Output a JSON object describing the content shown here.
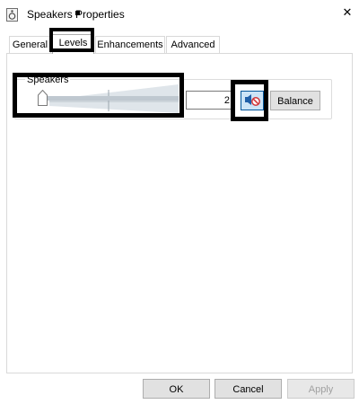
{
  "window": {
    "title": "Speakers Properties",
    "close_glyph": "✕"
  },
  "tabs": [
    {
      "label": "General",
      "active": false
    },
    {
      "label": "Levels",
      "active": true
    },
    {
      "label": "Enhancements",
      "active": false
    },
    {
      "label": "Advanced",
      "active": false
    }
  ],
  "levels": {
    "group_label": "Speakers",
    "volume_value": "2",
    "volume_level_percent": 2,
    "muted": true,
    "balance_label": "Balance"
  },
  "footer": {
    "ok_label": "OK",
    "cancel_label": "Cancel",
    "apply_label": "Apply"
  },
  "colors": {
    "mute_button_bg": "#cce4f7",
    "mute_icon_blue": "#1f5fa8",
    "mute_badge_red": "#d13438",
    "slider_fill": "#bfc8d0",
    "annotation_box": "#000000"
  },
  "icons": {
    "title": "speaker-properties-icon",
    "mute": "speaker-muted-icon",
    "thumb": "slider-thumb"
  }
}
